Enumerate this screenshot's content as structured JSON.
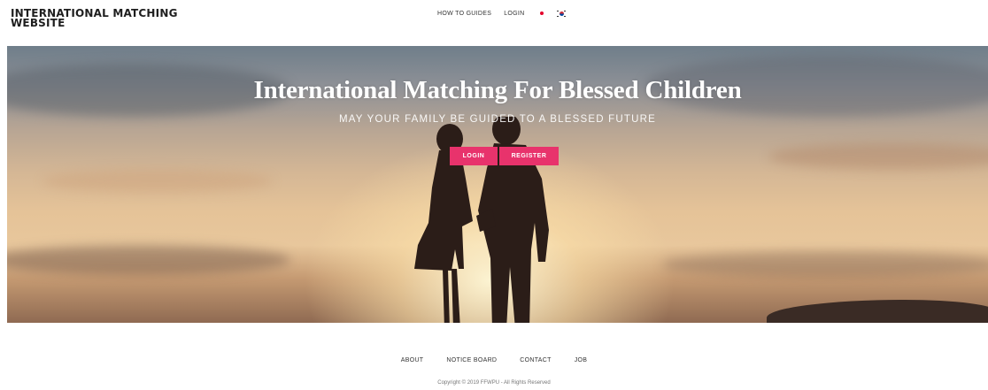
{
  "header": {
    "logo": "INTERNATIONAL MATCHING WEBSITE",
    "nav": {
      "how_to_guides": "HOW TO GUIDES",
      "login": "LOGIN"
    },
    "languages": [
      "japanese-flag-icon",
      "korean-flag-icon"
    ]
  },
  "hero": {
    "title": "International Matching For Blessed Children",
    "subtitle": "MAY YOUR FAMILY BE GUIDED TO A BLESSED FUTURE",
    "buttons": {
      "login": "LOGIN",
      "register": "REGISTER"
    }
  },
  "footer": {
    "links": [
      "ABOUT",
      "NOTICE BOARD",
      "CONTACT",
      "JOB"
    ],
    "copyright": "Copyright © 2019 FFWPU - All Rights Reserved"
  },
  "colors": {
    "accent": "#e8336c",
    "text": "#222222"
  }
}
